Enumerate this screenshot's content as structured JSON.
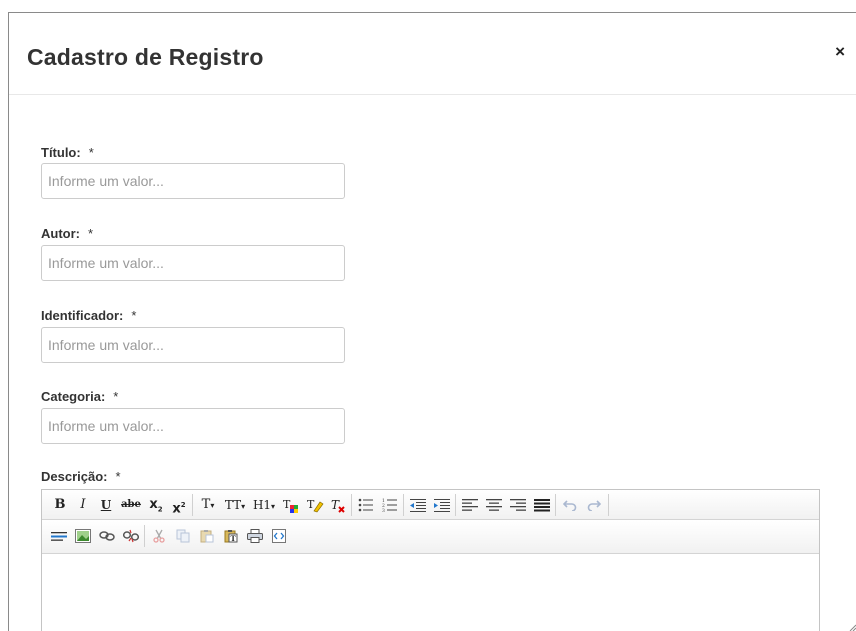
{
  "dialog": {
    "title": "Cadastro de Registro",
    "close_label": "×"
  },
  "form": {
    "required_marker": "*",
    "fields": [
      {
        "label": "Título:",
        "placeholder": "Informe um valor..."
      },
      {
        "label": "Autor:",
        "placeholder": "Informe um valor..."
      },
      {
        "label": "Identificador:",
        "placeholder": "Informe um valor..."
      },
      {
        "label": "Categoria:",
        "placeholder": "Informe um valor..."
      }
    ],
    "description_label": "Descrição:"
  },
  "editor": {
    "toolbar_labels": {
      "bold": "B",
      "italic": "I",
      "underline": "U",
      "strikethrough": "abe",
      "subscript": "x",
      "superscript": "x",
      "font_size": "T",
      "font_family": "TT",
      "heading": "H1"
    }
  }
}
